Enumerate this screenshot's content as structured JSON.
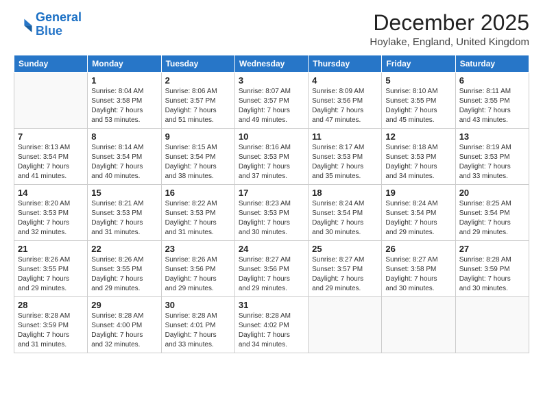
{
  "logo": {
    "line1": "General",
    "line2": "Blue"
  },
  "title": "December 2025",
  "subtitle": "Hoylake, England, United Kingdom",
  "days_of_week": [
    "Sunday",
    "Monday",
    "Tuesday",
    "Wednesday",
    "Thursday",
    "Friday",
    "Saturday"
  ],
  "weeks": [
    [
      {
        "day": "",
        "info": ""
      },
      {
        "day": "1",
        "info": "Sunrise: 8:04 AM\nSunset: 3:58 PM\nDaylight: 7 hours\nand 53 minutes."
      },
      {
        "day": "2",
        "info": "Sunrise: 8:06 AM\nSunset: 3:57 PM\nDaylight: 7 hours\nand 51 minutes."
      },
      {
        "day": "3",
        "info": "Sunrise: 8:07 AM\nSunset: 3:57 PM\nDaylight: 7 hours\nand 49 minutes."
      },
      {
        "day": "4",
        "info": "Sunrise: 8:09 AM\nSunset: 3:56 PM\nDaylight: 7 hours\nand 47 minutes."
      },
      {
        "day": "5",
        "info": "Sunrise: 8:10 AM\nSunset: 3:55 PM\nDaylight: 7 hours\nand 45 minutes."
      },
      {
        "day": "6",
        "info": "Sunrise: 8:11 AM\nSunset: 3:55 PM\nDaylight: 7 hours\nand 43 minutes."
      }
    ],
    [
      {
        "day": "7",
        "info": "Sunrise: 8:13 AM\nSunset: 3:54 PM\nDaylight: 7 hours\nand 41 minutes."
      },
      {
        "day": "8",
        "info": "Sunrise: 8:14 AM\nSunset: 3:54 PM\nDaylight: 7 hours\nand 40 minutes."
      },
      {
        "day": "9",
        "info": "Sunrise: 8:15 AM\nSunset: 3:54 PM\nDaylight: 7 hours\nand 38 minutes."
      },
      {
        "day": "10",
        "info": "Sunrise: 8:16 AM\nSunset: 3:53 PM\nDaylight: 7 hours\nand 37 minutes."
      },
      {
        "day": "11",
        "info": "Sunrise: 8:17 AM\nSunset: 3:53 PM\nDaylight: 7 hours\nand 35 minutes."
      },
      {
        "day": "12",
        "info": "Sunrise: 8:18 AM\nSunset: 3:53 PM\nDaylight: 7 hours\nand 34 minutes."
      },
      {
        "day": "13",
        "info": "Sunrise: 8:19 AM\nSunset: 3:53 PM\nDaylight: 7 hours\nand 33 minutes."
      }
    ],
    [
      {
        "day": "14",
        "info": "Sunrise: 8:20 AM\nSunset: 3:53 PM\nDaylight: 7 hours\nand 32 minutes."
      },
      {
        "day": "15",
        "info": "Sunrise: 8:21 AM\nSunset: 3:53 PM\nDaylight: 7 hours\nand 31 minutes."
      },
      {
        "day": "16",
        "info": "Sunrise: 8:22 AM\nSunset: 3:53 PM\nDaylight: 7 hours\nand 31 minutes."
      },
      {
        "day": "17",
        "info": "Sunrise: 8:23 AM\nSunset: 3:53 PM\nDaylight: 7 hours\nand 30 minutes."
      },
      {
        "day": "18",
        "info": "Sunrise: 8:24 AM\nSunset: 3:54 PM\nDaylight: 7 hours\nand 30 minutes."
      },
      {
        "day": "19",
        "info": "Sunrise: 8:24 AM\nSunset: 3:54 PM\nDaylight: 7 hours\nand 29 minutes."
      },
      {
        "day": "20",
        "info": "Sunrise: 8:25 AM\nSunset: 3:54 PM\nDaylight: 7 hours\nand 29 minutes."
      }
    ],
    [
      {
        "day": "21",
        "info": "Sunrise: 8:26 AM\nSunset: 3:55 PM\nDaylight: 7 hours\nand 29 minutes."
      },
      {
        "day": "22",
        "info": "Sunrise: 8:26 AM\nSunset: 3:55 PM\nDaylight: 7 hours\nand 29 minutes."
      },
      {
        "day": "23",
        "info": "Sunrise: 8:26 AM\nSunset: 3:56 PM\nDaylight: 7 hours\nand 29 minutes."
      },
      {
        "day": "24",
        "info": "Sunrise: 8:27 AM\nSunset: 3:56 PM\nDaylight: 7 hours\nand 29 minutes."
      },
      {
        "day": "25",
        "info": "Sunrise: 8:27 AM\nSunset: 3:57 PM\nDaylight: 7 hours\nand 29 minutes."
      },
      {
        "day": "26",
        "info": "Sunrise: 8:27 AM\nSunset: 3:58 PM\nDaylight: 7 hours\nand 30 minutes."
      },
      {
        "day": "27",
        "info": "Sunrise: 8:28 AM\nSunset: 3:59 PM\nDaylight: 7 hours\nand 30 minutes."
      }
    ],
    [
      {
        "day": "28",
        "info": "Sunrise: 8:28 AM\nSunset: 3:59 PM\nDaylight: 7 hours\nand 31 minutes."
      },
      {
        "day": "29",
        "info": "Sunrise: 8:28 AM\nSunset: 4:00 PM\nDaylight: 7 hours\nand 32 minutes."
      },
      {
        "day": "30",
        "info": "Sunrise: 8:28 AM\nSunset: 4:01 PM\nDaylight: 7 hours\nand 33 minutes."
      },
      {
        "day": "31",
        "info": "Sunrise: 8:28 AM\nSunset: 4:02 PM\nDaylight: 7 hours\nand 34 minutes."
      },
      {
        "day": "",
        "info": ""
      },
      {
        "day": "",
        "info": ""
      },
      {
        "day": "",
        "info": ""
      }
    ]
  ]
}
